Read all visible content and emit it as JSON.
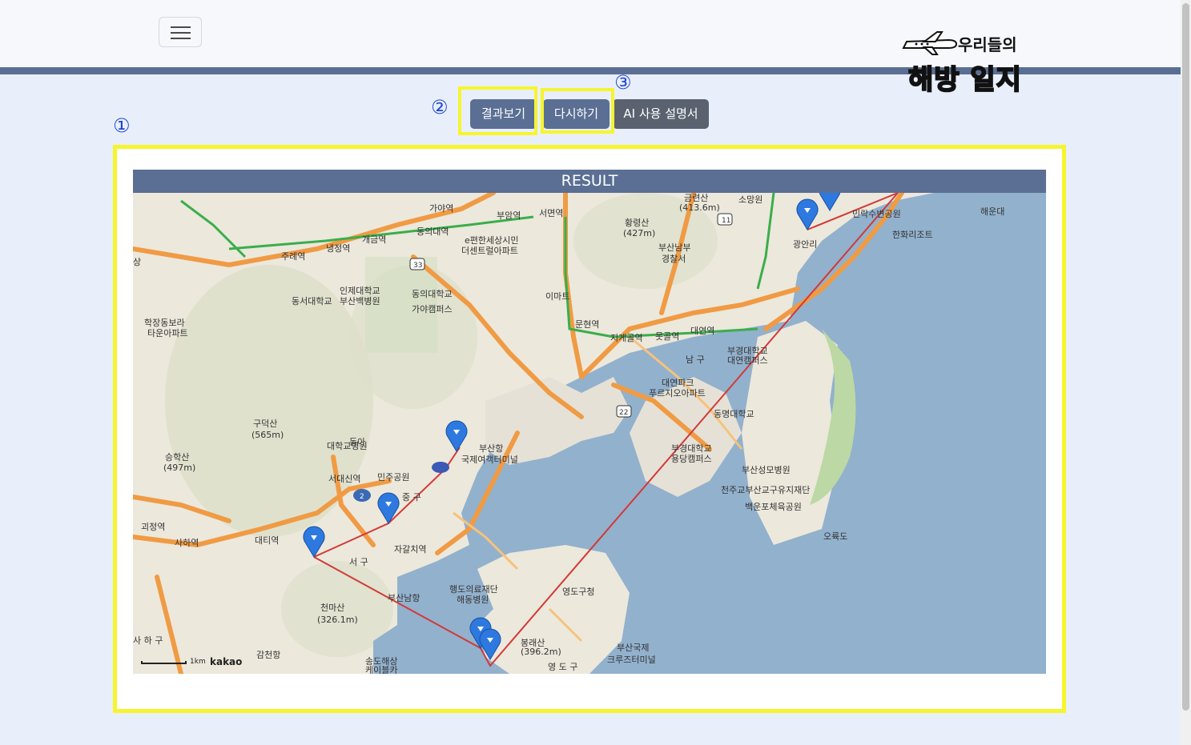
{
  "header": {
    "logo_small": "우리들의",
    "logo_big": "해방 일지"
  },
  "buttons": {
    "result": "결과보기",
    "retry": "다시하기",
    "guide": "AI 사용 설명서"
  },
  "annotations": {
    "one": "①",
    "two": "②",
    "three": "③"
  },
  "panel": {
    "title": "RESULT"
  },
  "map": {
    "attribution": "kakao",
    "scale": "1km",
    "labels": [
      {
        "id": "seomyeon",
        "text": "서면역"
      },
      {
        "id": "gaya",
        "text": "가야역"
      },
      {
        "id": "hwangnyeongsan",
        "text": "황령산"
      },
      {
        "id": "hwangnyeongsan_h",
        "text": "(427m)"
      },
      {
        "id": "geumryeonsan",
        "text": "금련산"
      },
      {
        "id": "geumryeonsan_h",
        "text": "(413.6m)"
      },
      {
        "id": "soman",
        "text": "소망원"
      },
      {
        "id": "minrak",
        "text": "민락수변공원"
      },
      {
        "id": "haeundae",
        "text": "해운대"
      },
      {
        "id": "hanhwa",
        "text": "한화리조트"
      },
      {
        "id": "gwangalli",
        "text": "광안리"
      },
      {
        "id": "busannambu",
        "text": "부산남부"
      },
      {
        "id": "police",
        "text": "경찰서"
      },
      {
        "id": "emart",
        "text": "이마트"
      },
      {
        "id": "efeeling",
        "text": "e편한세상시민"
      },
      {
        "id": "thecentreal",
        "text": "더센트럴아파트"
      },
      {
        "id": "inje",
        "text": "인제대학교"
      },
      {
        "id": "busanpaik",
        "text": "부산백병원"
      },
      {
        "id": "dongseo",
        "text": "동서대학교"
      },
      {
        "id": "dongeui",
        "text": "동의대학교"
      },
      {
        "id": "gayacampus",
        "text": "가야캠퍼스"
      },
      {
        "id": "hakjang",
        "text": "학장동보라"
      },
      {
        "id": "tawon",
        "text": "타운아파트"
      },
      {
        "id": "namgu",
        "text": "남 구"
      },
      {
        "id": "pknu",
        "text": "부경대학교"
      },
      {
        "id": "daeyeon",
        "text": "대연캠퍼스"
      },
      {
        "id": "daeyeonpark",
        "text": "대연파크"
      },
      {
        "id": "prugio",
        "text": "푸르지오아파트"
      },
      {
        "id": "tongmyong",
        "text": "동명대학교"
      },
      {
        "id": "pknu2",
        "text": "부경대학교"
      },
      {
        "id": "yongdang",
        "text": "용당캠퍼스"
      },
      {
        "id": "busanport",
        "text": "부산항"
      },
      {
        "id": "ferry",
        "text": "국제여객터미널"
      },
      {
        "id": "guduk",
        "text": "구덕산"
      },
      {
        "id": "guduk_h",
        "text": "(565m)"
      },
      {
        "id": "donga",
        "text": "동아"
      },
      {
        "id": "dongahosp",
        "text": "대학교병원"
      },
      {
        "id": "seunghak",
        "text": "승학산"
      },
      {
        "id": "seunghak_h",
        "text": "(497m)"
      },
      {
        "id": "minju",
        "text": "민주공원"
      },
      {
        "id": "junggu",
        "text": "중 구"
      },
      {
        "id": "seogu",
        "text": "서 구"
      },
      {
        "id": "busannam",
        "text": "부산남항"
      },
      {
        "id": "haengdo",
        "text": "행도의료재단"
      },
      {
        "id": "haedong",
        "text": "해동병원"
      },
      {
        "id": "yeongdo",
        "text": "영도구청"
      },
      {
        "id": "cheonma",
        "text": "천마산"
      },
      {
        "id": "cheonma_h",
        "text": "(326.1m)"
      },
      {
        "id": "bongrae",
        "text": "봉래산"
      },
      {
        "id": "bongrae_h",
        "text": "(396.2m)"
      },
      {
        "id": "yeongdogu",
        "text": "영 도 구"
      },
      {
        "id": "songdo",
        "text": "송도해상"
      },
      {
        "id": "cable",
        "text": "케이블카"
      },
      {
        "id": "gamcheon",
        "text": "감천항"
      },
      {
        "id": "saha",
        "text": "사 하 구"
      },
      {
        "id": "cruise1",
        "text": "부산국제"
      },
      {
        "id": "cruise2",
        "text": "크루즈터미널"
      },
      {
        "id": "seongmo",
        "text": "부산성모병원"
      },
      {
        "id": "cheonju",
        "text": "천주교부산교구유지재단"
      },
      {
        "id": "baekun",
        "text": "백운포체육공원"
      },
      {
        "id": "oryukdo",
        "text": "오륙도"
      },
      {
        "id": "gaegeum",
        "text": "개금역"
      },
      {
        "id": "jurye",
        "text": "주례역"
      },
      {
        "id": "naengjeong",
        "text": "냉정역"
      },
      {
        "id": "dongeuiyeok",
        "text": "동의대역"
      },
      {
        "id": "buam",
        "text": "부암역"
      },
      {
        "id": "munhyeon",
        "text": "문현역"
      },
      {
        "id": "jigegol",
        "text": "지게골역"
      },
      {
        "id": "motgol",
        "text": "못골역"
      },
      {
        "id": "daeyeonyeok",
        "text": "대연역"
      },
      {
        "id": "sinpyeong",
        "text": "사하역"
      },
      {
        "id": "jagalchi",
        "text": "자갈치역"
      },
      {
        "id": "seodaesin",
        "text": "서대신역"
      },
      {
        "id": "daeti",
        "text": "대티역"
      },
      {
        "id": "goejeong",
        "text": "괴정역"
      },
      {
        "id": "sasang",
        "text": "상"
      }
    ]
  }
}
